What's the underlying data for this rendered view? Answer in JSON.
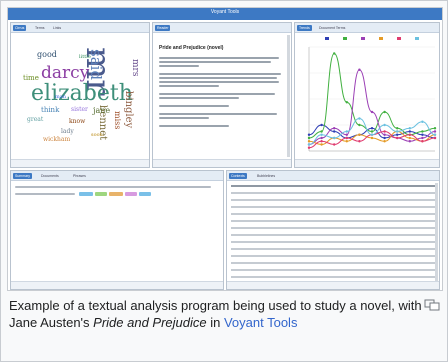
{
  "app": {
    "title": "Voyant Tools",
    "brand_color": "#3d79c4"
  },
  "panels": {
    "cirrus": {
      "tabs": [
        "Cirrus",
        "Terms",
        "Links"
      ]
    },
    "reader": {
      "tabs": [
        "Reader"
      ],
      "text_title": "Pride and Prejudice (novel)"
    },
    "trends": {
      "tabs": [
        "Trends",
        "Document Terms"
      ]
    },
    "summary": {
      "tabs": [
        "Summary",
        "Documents",
        "Phrases"
      ]
    },
    "contexts": {
      "tabs": [
        "Contexts",
        "Bubblelines"
      ]
    }
  },
  "word_cloud": [
    {
      "text": "mr",
      "color": "#4a5a8c"
    },
    {
      "text": "elizabeth",
      "color": "#3e8f7a"
    },
    {
      "text": "darcy",
      "color": "#8c3fa3"
    },
    {
      "text": "said",
      "color": "#5a7fb8"
    },
    {
      "text": "mrs",
      "color": "#6a4f8f"
    },
    {
      "text": "bennet",
      "color": "#7a6c3a"
    },
    {
      "text": "bingley",
      "color": "#8d5b3f"
    },
    {
      "text": "jane",
      "color": "#556b2f"
    },
    {
      "text": "good",
      "color": "#2f4f6f"
    },
    {
      "text": "miss",
      "color": "#a0522d"
    },
    {
      "text": "think",
      "color": "#4682b4"
    },
    {
      "text": "time",
      "color": "#6b8e23"
    },
    {
      "text": "know",
      "color": "#8b4513"
    },
    {
      "text": "lady",
      "color": "#708090"
    },
    {
      "text": "sister",
      "color": "#9370db"
    },
    {
      "text": "great",
      "color": "#5f9ea0"
    },
    {
      "text": "wickham",
      "color": "#cd853f"
    },
    {
      "text": "little",
      "color": "#2e8b57"
    },
    {
      "text": "soon",
      "color": "#b8860b"
    },
    {
      "text": "man",
      "color": "#4169e1"
    }
  ],
  "chart_data": {
    "type": "line",
    "series": [
      {
        "color": "#2f3fb5",
        "values": [
          0.05,
          0.08,
          0.06,
          0.04,
          0.05,
          0.07,
          0.04,
          0.05,
          0.06,
          0.05,
          0.04
        ]
      },
      {
        "color": "#41b040",
        "values": [
          0.04,
          0.06,
          0.3,
          0.15,
          0.08,
          0.06,
          0.12,
          0.07,
          0.05,
          0.06,
          0.07
        ]
      },
      {
        "color": "#9b3fb5",
        "values": [
          0.02,
          0.04,
          0.07,
          0.05,
          0.25,
          0.12,
          0.05,
          0.04,
          0.03,
          0.04,
          0.06
        ]
      },
      {
        "color": "#e59b27",
        "values": [
          0.03,
          0.02,
          0.04,
          0.03,
          0.05,
          0.04,
          0.03,
          0.06,
          0.04,
          0.03,
          0.05
        ]
      },
      {
        "color": "#e03b6f",
        "values": [
          0.01,
          0.03,
          0.02,
          0.04,
          0.03,
          0.05,
          0.06,
          0.04,
          0.05,
          0.03,
          0.04
        ]
      },
      {
        "color": "#6bc1e0",
        "values": [
          0.02,
          0.05,
          0.04,
          0.06,
          0.1,
          0.05,
          0.08,
          0.06,
          0.07,
          0.09,
          0.05
        ]
      }
    ]
  },
  "caption": {
    "prefix": "Example of a textual analysis program being used to study a novel, with Jane Austen's ",
    "work": "Pride and Prejudice",
    "middle": " in ",
    "link": "Voyant Tools"
  },
  "icons": {
    "enlarge": "magnify-icon"
  }
}
